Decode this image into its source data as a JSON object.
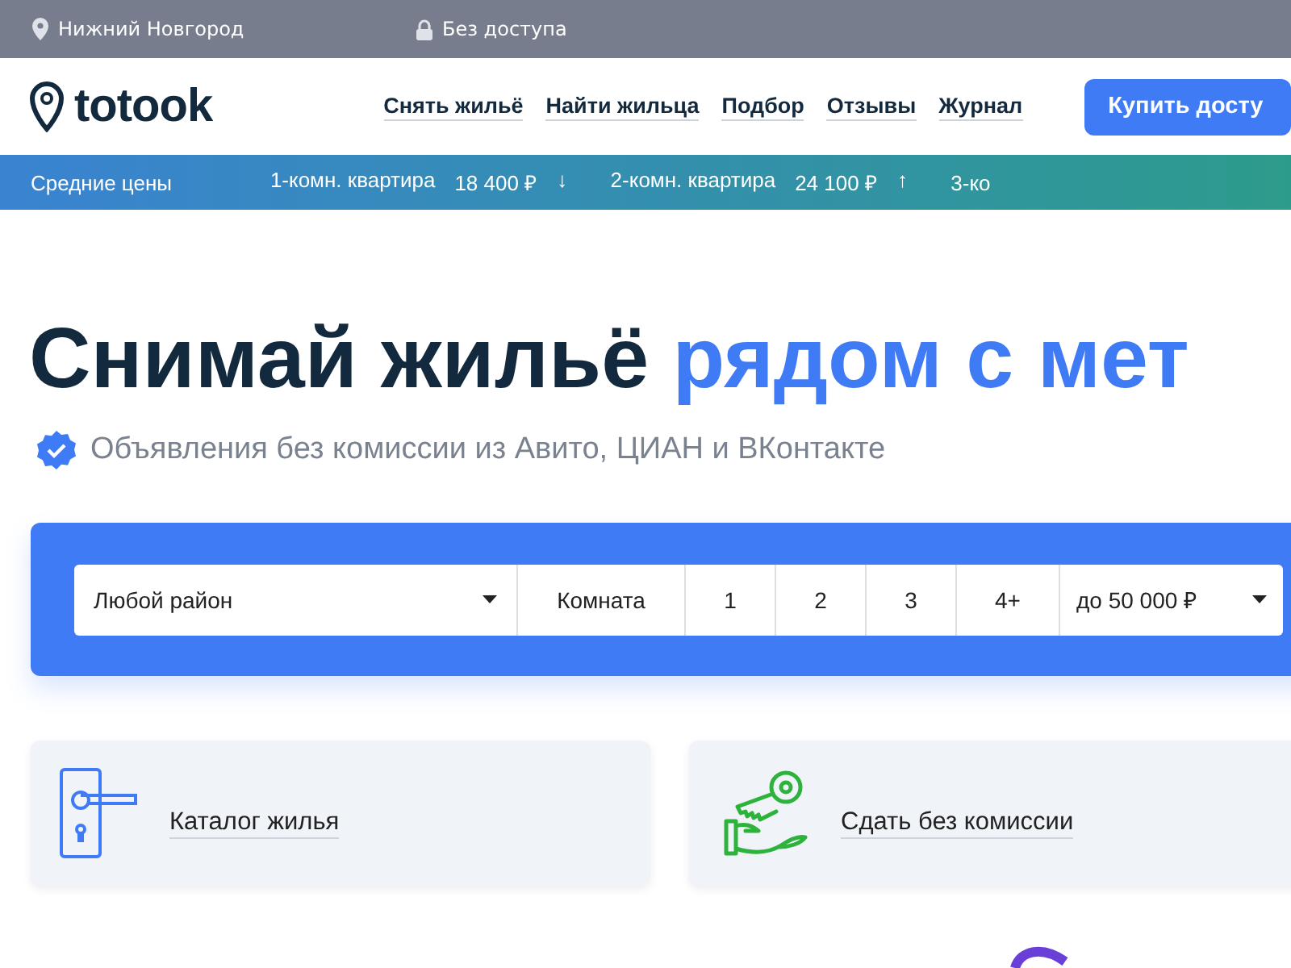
{
  "top_bar": {
    "city": "Нижний Новгород",
    "access": "Без доступа"
  },
  "header": {
    "logo": "totook",
    "nav": [
      {
        "label": "Снять жильё"
      },
      {
        "label": "Найти жильца"
      },
      {
        "label": "Подбор"
      },
      {
        "label": "Отзывы"
      },
      {
        "label": "Журнал"
      }
    ],
    "button": "Купить досту"
  },
  "price_bar": {
    "label": "Средние цены",
    "items": [
      {
        "name": "1-комн. квартира",
        "price": "18 400 ₽",
        "trend": "↓"
      },
      {
        "name": "2-комн. квартира",
        "price": "24 100 ₽",
        "trend": "↑"
      },
      {
        "name": "3-ко"
      }
    ]
  },
  "hero": {
    "title": "Снимай жильё",
    "title_accent": "рядом с мет",
    "subtitle": "Объявления без комиссии из Авито, ЦИАН и ВКонтакте"
  },
  "search": {
    "district": "Любой район",
    "rooms": [
      {
        "label": "Комната",
        "selected": false
      },
      {
        "label": "1",
        "selected": false
      },
      {
        "label": "2",
        "selected": false
      },
      {
        "label": "3",
        "selected": false
      },
      {
        "label": "4+",
        "selected": false
      }
    ],
    "price": "до 50 000 ₽"
  },
  "cards": [
    {
      "kind": "door",
      "label": "Каталог жилья"
    },
    {
      "kind": "key",
      "label": "Сдать без комиссии"
    }
  ]
}
